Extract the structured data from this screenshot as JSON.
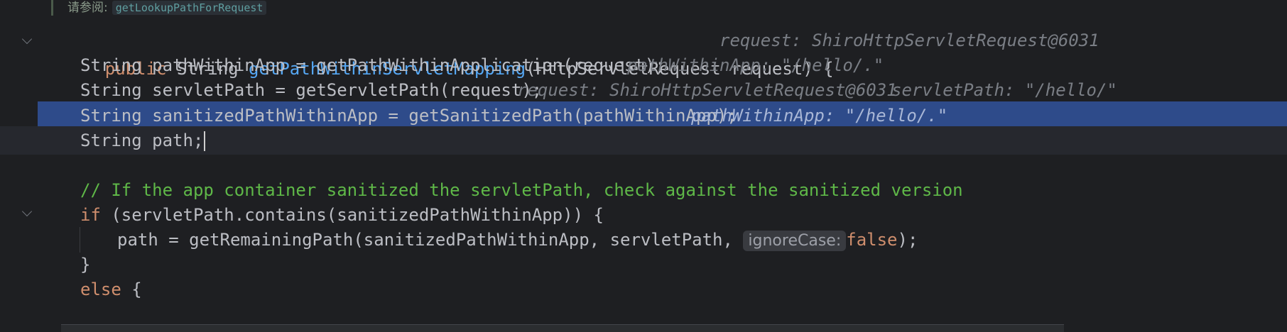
{
  "doc_comment": {
    "label": "请参阅:",
    "link": "getLookupPathForRequest"
  },
  "line1": {
    "kw": "public",
    "t1": " String ",
    "fn": "getPathWithinServletMapping",
    "t2": "(HttpServletRequest request) {",
    "hint": "request: ShiroHttpServletRequest@6031"
  },
  "line2": {
    "code": "String pathWithinApp = getPathWithinApplication(request);",
    "hint": "pathWithinApp: \"/hello/.\""
  },
  "line3": {
    "code": "String servletPath = getServletPath(request);",
    "hint1": "request: ShiroHttpServletRequest@6031",
    "hint2": "servletPath: \"/hello/\""
  },
  "line4": {
    "code": "String sanitizedPathWithinApp = getSanitizedPath(pathWithinApp);",
    "hint": "pathWithinApp: \"/hello/.\""
  },
  "line5": {
    "code": "String path;"
  },
  "line7": {
    "comment": "// If the app container sanitized the servletPath, check against the sanitized version"
  },
  "line8": {
    "kw": "if",
    "code": " (servletPath.contains(sanitizedPathWithinApp)) {"
  },
  "line9": {
    "code": "path = getRemainingPath(sanitizedPathWithinApp, servletPath, ",
    "param_hint": "ignoreCase:",
    "kw": "false",
    "tail": ");"
  },
  "line10": {
    "code": "}"
  },
  "line11": {
    "kw": "else",
    "code": " {"
  },
  "colors": {
    "background": "#1e1f22",
    "selection": "#2e4b8a",
    "keyword": "#cf8e6d",
    "function": "#56a8f5",
    "comment": "#5fb848"
  }
}
